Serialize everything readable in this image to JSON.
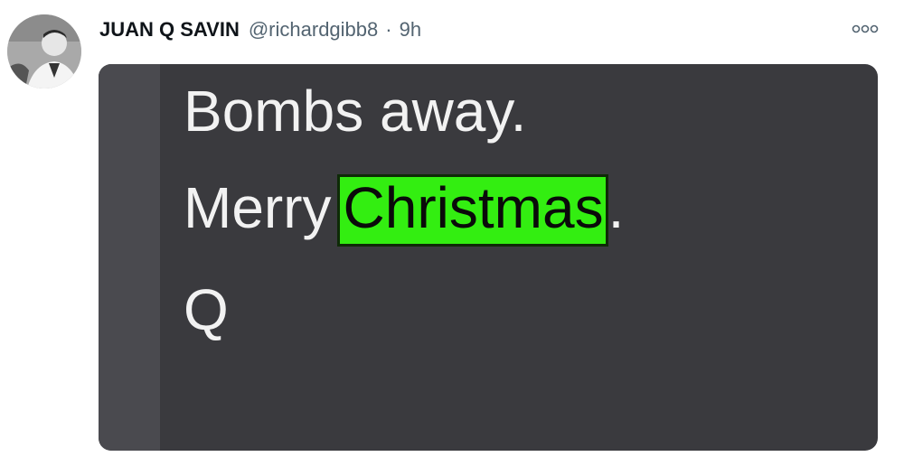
{
  "tweet": {
    "display_name": "JUAN Q SAVIN",
    "handle": "@richardgibb8",
    "separator": "·",
    "time": "9h",
    "more_icon": "more-icon"
  },
  "image": {
    "line1": "Bombs away.",
    "line2_prefix": "Merry",
    "line2_highlight": "Christmas",
    "line2_suffix": ".",
    "line3": "Q",
    "colors": {
      "background": "#3a3a3e",
      "bar": "#4a4a4f",
      "text": "#f2f2f2",
      "highlight": "#33ee11"
    }
  }
}
